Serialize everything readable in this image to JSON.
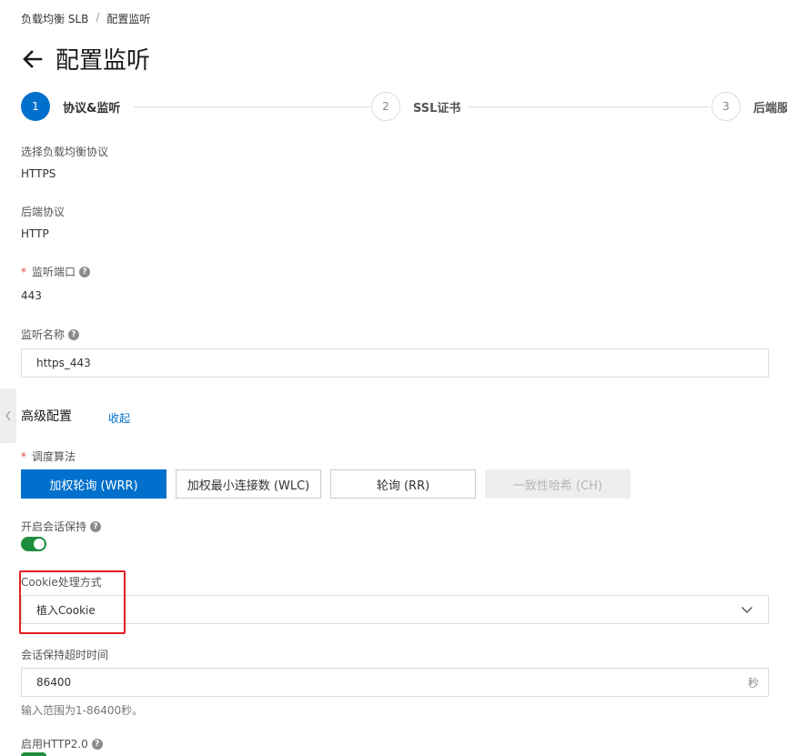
{
  "breadcrumb": {
    "items": [
      "负载均衡 SLB",
      "配置监听"
    ],
    "separator": "/"
  },
  "page": {
    "title": "配置监听",
    "back_icon": "arrow-left-icon"
  },
  "steps": [
    {
      "number": "1",
      "label": "协议&监听",
      "state": "active"
    },
    {
      "number": "2",
      "label": "SSL证书",
      "state": "inactive"
    },
    {
      "number": "3",
      "label": "后端服",
      "state": "inactive"
    }
  ],
  "fields": {
    "protocol": {
      "label": "选择负载均衡协议",
      "value": "HTTPS"
    },
    "backend_protocol": {
      "label": "后端协议",
      "value": "HTTP"
    },
    "listen_port": {
      "required_mark": "*",
      "label": "监听端口",
      "value": "443",
      "help": "?"
    },
    "listen_name": {
      "label": "监听名称",
      "value": "https_443",
      "help": "?"
    }
  },
  "advanced": {
    "title": "高级配置",
    "collapse_label": "收起",
    "algorithm": {
      "required_mark": "*",
      "label": "调度算法",
      "options": [
        {
          "label": "加权轮询 (WRR)",
          "state": "active"
        },
        {
          "label": "加权最小连接数 (WLC)",
          "state": "normal"
        },
        {
          "label": "轮询 (RR)",
          "state": "normal"
        },
        {
          "label": "一致性哈希 (CH)",
          "state": "disabled"
        }
      ]
    },
    "session_persistence": {
      "label": "开启会话保持",
      "help": "?",
      "enabled": true
    },
    "cookie_mode": {
      "label": "Cookie处理方式",
      "value": "植入Cookie",
      "icon": "chevron-down-icon"
    },
    "session_timeout": {
      "label": "会话保持超时时间",
      "value": "86400",
      "suffix": "秒",
      "hint": "输入范围为1-86400秒。"
    },
    "http2": {
      "label": "启用HTTP2.0",
      "help": "?",
      "enabled": true
    }
  },
  "colors": {
    "primary": "#0070cc",
    "toggle_on": "#1e8e3e",
    "highlight": "#e02020",
    "required": "#e64545"
  }
}
